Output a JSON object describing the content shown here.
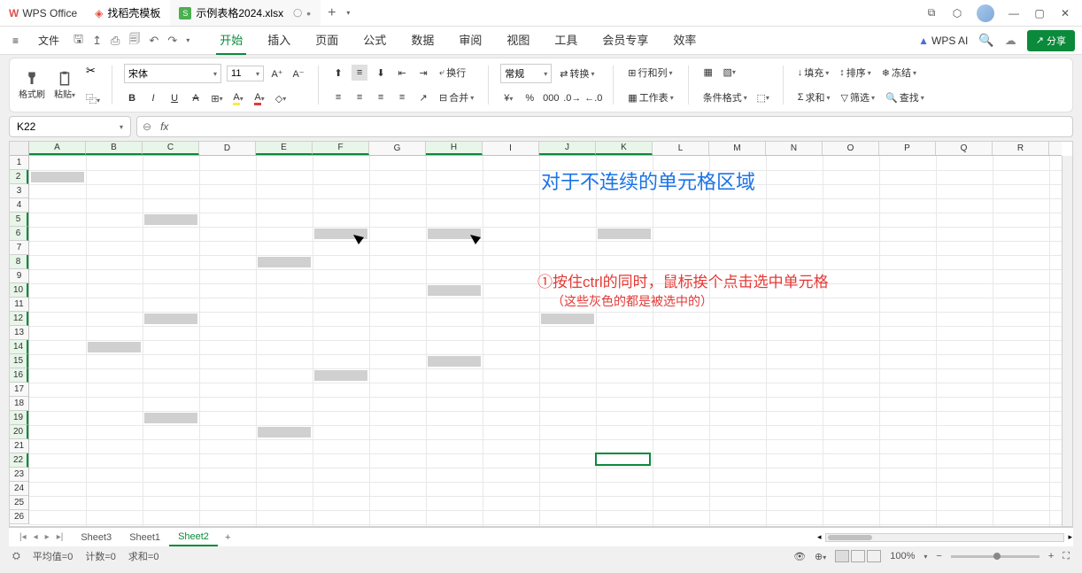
{
  "app_name": "WPS Office",
  "tabs": [
    {
      "label": "找稻壳模板"
    },
    {
      "label": "示例表格2024.xlsx"
    }
  ],
  "file_menu": "文件",
  "menu_tabs": [
    "开始",
    "插入",
    "页面",
    "公式",
    "数据",
    "审阅",
    "视图",
    "工具",
    "会员专享",
    "效率"
  ],
  "wps_ai": "WPS AI",
  "share": "分享",
  "ribbon": {
    "format_painter": "格式刷",
    "paste": "粘贴",
    "font_name": "宋体",
    "font_size": "11",
    "wrap": "换行",
    "merge": "合并",
    "number_fmt": "常规",
    "convert": "转换",
    "rowcol": "行和列",
    "worksheet": "工作表",
    "cond_fmt": "条件格式",
    "fill": "填充",
    "sum": "求和",
    "sort": "排序",
    "filter": "筛选",
    "freeze": "冻结",
    "find": "查找"
  },
  "namebox": "K22",
  "columns": [
    "A",
    "B",
    "C",
    "D",
    "E",
    "F",
    "G",
    "H",
    "I",
    "J",
    "K",
    "L",
    "M",
    "N",
    "O",
    "P",
    "Q",
    "R"
  ],
  "rows_count": 26,
  "selected_cells": [
    {
      "c": 0,
      "r": 1
    },
    {
      "c": 2,
      "r": 4
    },
    {
      "c": 5,
      "r": 5
    },
    {
      "c": 7,
      "r": 5
    },
    {
      "c": 10,
      "r": 5
    },
    {
      "c": 4,
      "r": 7
    },
    {
      "c": 7,
      "r": 9
    },
    {
      "c": 2,
      "r": 11
    },
    {
      "c": 9,
      "r": 11
    },
    {
      "c": 1,
      "r": 13
    },
    {
      "c": 7,
      "r": 14
    },
    {
      "c": 5,
      "r": 15
    },
    {
      "c": 2,
      "r": 18
    },
    {
      "c": 4,
      "r": 19
    }
  ],
  "active_cell": {
    "c": 10,
    "r": 21
  },
  "highlighted_rows": [
    1,
    4,
    5,
    7,
    9,
    11,
    13,
    14,
    15,
    18,
    19,
    21
  ],
  "annotations": {
    "title": "对于不连续的单元格区域",
    "line1": "①按住ctrl的同时，鼠标挨个点击选中单元格",
    "line2": "（这些灰色的都是被选中的）"
  },
  "sheets": [
    "Sheet3",
    "Sheet1",
    "Sheet2"
  ],
  "active_sheet": "Sheet2",
  "status": {
    "avg": "平均值=0",
    "count": "计数=0",
    "sum": "求和=0"
  },
  "zoom": "100%"
}
